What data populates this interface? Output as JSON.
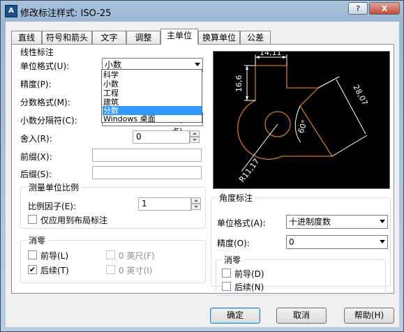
{
  "window": {
    "title": "修改标注样式: ISO-25",
    "icon_text": "A",
    "help_btn": "?",
    "close_btn": "X"
  },
  "tabs": [
    {
      "label": "直线"
    },
    {
      "label": "符号和箭头"
    },
    {
      "label": "文字"
    },
    {
      "label": "调整"
    },
    {
      "label": "主单位"
    },
    {
      "label": "换算单位"
    },
    {
      "label": "公差"
    }
  ],
  "active_tab": "主单位",
  "linear": {
    "title": "线性标注",
    "unit_format_label": "单位格式(U):",
    "unit_format_value": "小数",
    "precision_label": "精度(P):",
    "fraction_format_label": "分数格式(M):",
    "decimal_sep_label": "小数分隔符(C):",
    "decimal_sep_value": "，(逗点)",
    "roundoff_label": "舍入(R):",
    "roundoff_value": "0",
    "prefix_label": "前缀(X):",
    "prefix_value": "",
    "suffix_label": "后缀(S):",
    "suffix_value": ""
  },
  "unit_format_options": [
    "科学",
    "小数",
    "工程",
    "建筑",
    "分数",
    "Windows 桌面"
  ],
  "unit_format_highlighted": "分数",
  "scale": {
    "title": "测量单位比例",
    "factor_label": "比例因子(E):",
    "factor_value": "1",
    "layout_only_label": "仅应用到布局标注",
    "layout_only_checked": false
  },
  "linear_zero": {
    "title": "消零",
    "leading_label": "前导(L)",
    "leading_checked": false,
    "trailing_label": "后续(T)",
    "trailing_checked": true,
    "feet_label": "0 英尺(F)",
    "inches_label": "0 英寸(I)"
  },
  "preview": {
    "dim_top": "14,11",
    "dim_left": "16,6",
    "dim_right": "28,07",
    "dim_angle": "60°",
    "dim_radius": "R11,17"
  },
  "angular": {
    "title": "角度标注",
    "unit_format_label": "单位格式(A):",
    "unit_format_value": "十进制度数",
    "precision_label": "精度(O):",
    "precision_value": "0",
    "zero_title": "消零",
    "leading_label": "前导(D)",
    "leading_checked": false,
    "trailing_label": "后续(N)",
    "trailing_checked": false
  },
  "buttons": {
    "ok": "确定",
    "cancel": "取消",
    "help": "帮助(H)"
  },
  "colors": {
    "preview_line": "#ffffff",
    "preview_shape": "#c8782a",
    "selection": "#3399ff"
  }
}
